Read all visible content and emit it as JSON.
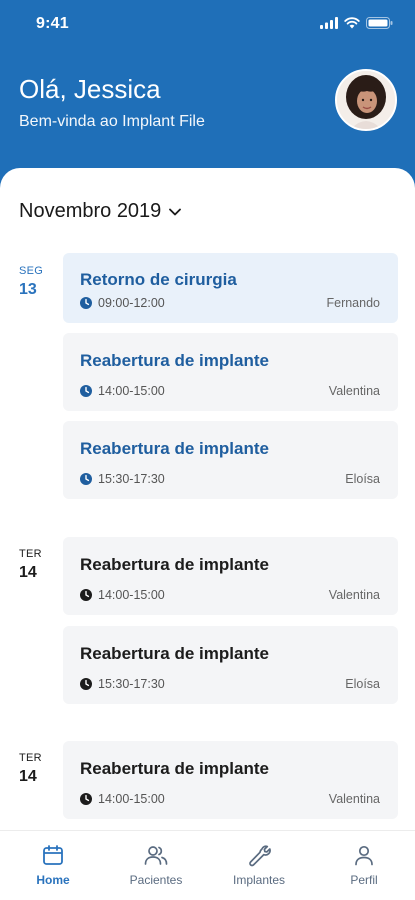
{
  "status_bar": {
    "time": "9:41"
  },
  "header": {
    "greeting": "Olá, Jessica",
    "subtitle": "Bem-vinda ao Implant File"
  },
  "month_selector": {
    "label": "Novembro 2019"
  },
  "days": [
    {
      "weekday": "SEG",
      "number": "13"
    },
    {
      "weekday": "TER",
      "number": "14"
    },
    {
      "weekday": "TER",
      "number": "14"
    }
  ],
  "events": [
    {
      "title": "Retorno de cirurgia",
      "time": "09:00-12:00",
      "person": "Fernando"
    },
    {
      "title": "Reabertura de implante",
      "time": "14:00-15:00",
      "person": "Valentina"
    },
    {
      "title": "Reabertura de implante",
      "time": "15:30-17:30",
      "person": "Eloísa"
    },
    {
      "title": "Reabertura de implante",
      "time": "14:00-15:00",
      "person": "Valentina"
    },
    {
      "title": "Reabertura de implante",
      "time": "15:30-17:30",
      "person": "Eloísa"
    },
    {
      "title": "Reabertura de implante",
      "time": "14:00-15:00",
      "person": "Valentina"
    }
  ],
  "bottom_nav": [
    {
      "label": "Home",
      "icon": "calendar-icon",
      "active": true
    },
    {
      "label": "Pacientes",
      "icon": "users-icon",
      "active": false
    },
    {
      "label": "Implantes",
      "icon": "wrench-icon",
      "active": false
    },
    {
      "label": "Perfil",
      "icon": "user-icon",
      "active": false
    }
  ],
  "colors": {
    "primary": "#1f6fb8",
    "accent_text": "#2a73bd",
    "card_bg": "#f4f5f7",
    "card_highlight_bg": "#e9f1fa"
  }
}
